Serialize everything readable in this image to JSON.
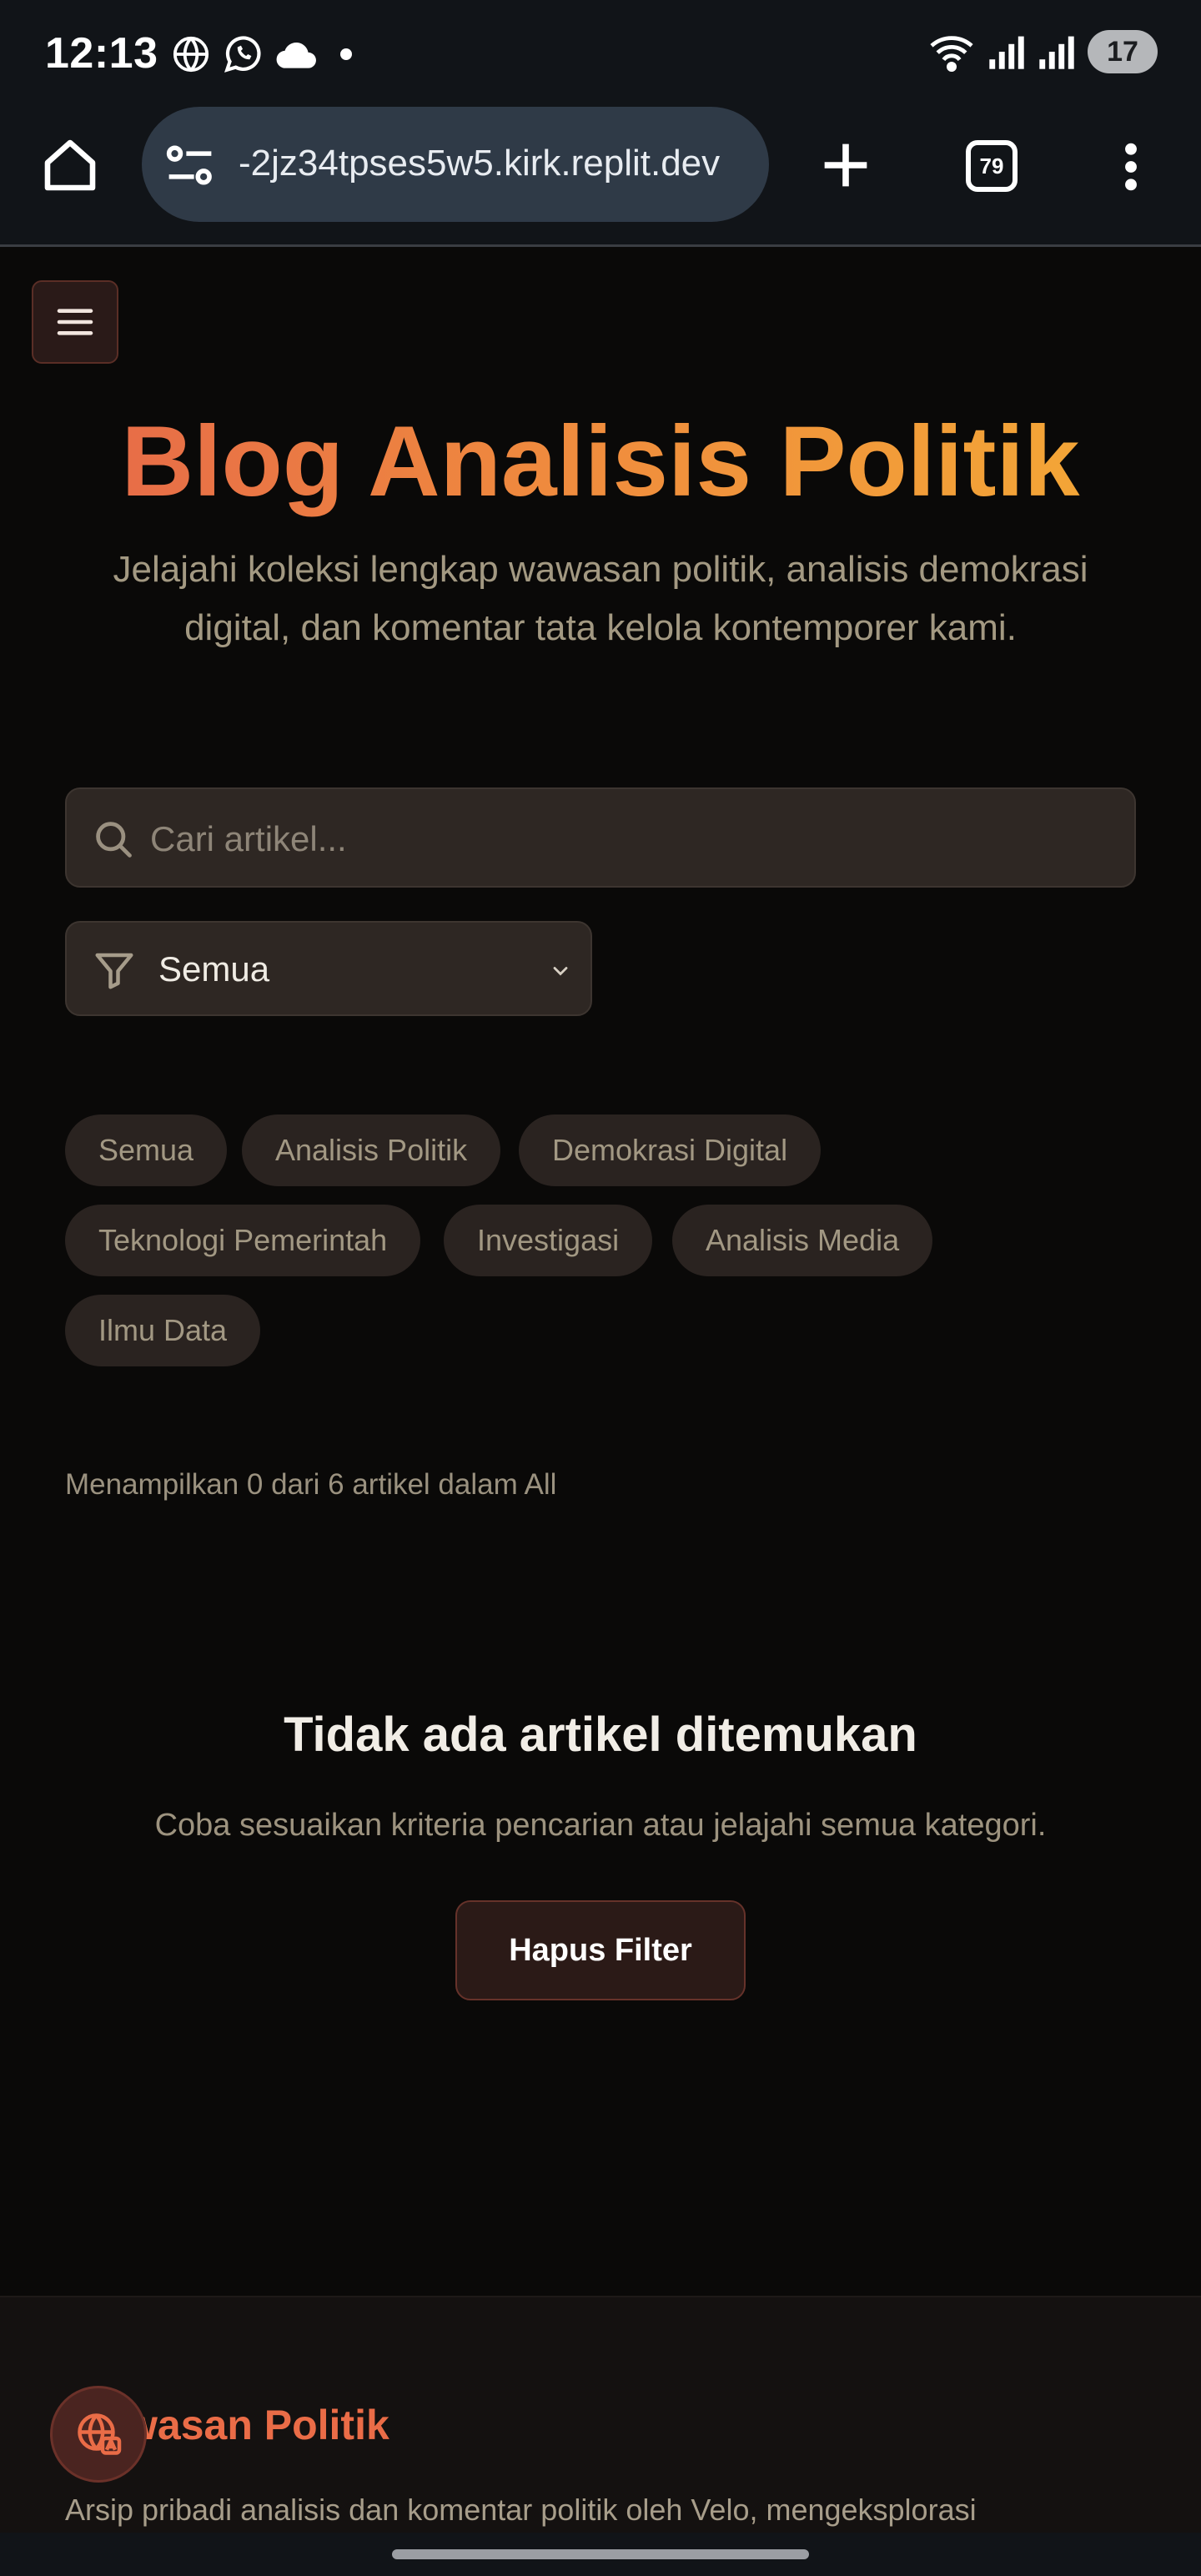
{
  "status_bar": {
    "time": "12:13",
    "battery": "17"
  },
  "browser": {
    "url": "-2jz34tpses5w5.kirk.replit.dev",
    "tab_count": "79"
  },
  "page": {
    "title": "Blog Analisis Politik",
    "subtitle": "Jelajahi koleksi lengkap wawasan politik, analisis demokrasi digital, dan komentar tata kelola kontemporer kami.",
    "search_placeholder": "Cari artikel...",
    "category_select": "Semua",
    "chips": [
      {
        "label": "Semua"
      },
      {
        "label": "Analisis Politik"
      },
      {
        "label": "Demokrasi Digital"
      },
      {
        "label": "Teknologi Pemerintah"
      },
      {
        "label": "Investigasi"
      },
      {
        "label": "Analisis Media"
      },
      {
        "label": "Ilmu Data"
      }
    ],
    "result_count": "Menampilkan 0 dari 6 artikel dalam All",
    "empty_title": "Tidak ada artikel ditemukan",
    "empty_desc": "Coba sesuaikan kriteria pencarian atau jelajahi semua kategori.",
    "clear_button": "Hapus Filter"
  },
  "footer": {
    "brand": "wasan Politik",
    "description": "Arsip pribadi analisis dan komentar politik oleh Velo, mengeksplorasi"
  },
  "colors": {
    "accent": "#ea6c47",
    "background": "#0a0908",
    "chip_bg": "#2a2320"
  }
}
